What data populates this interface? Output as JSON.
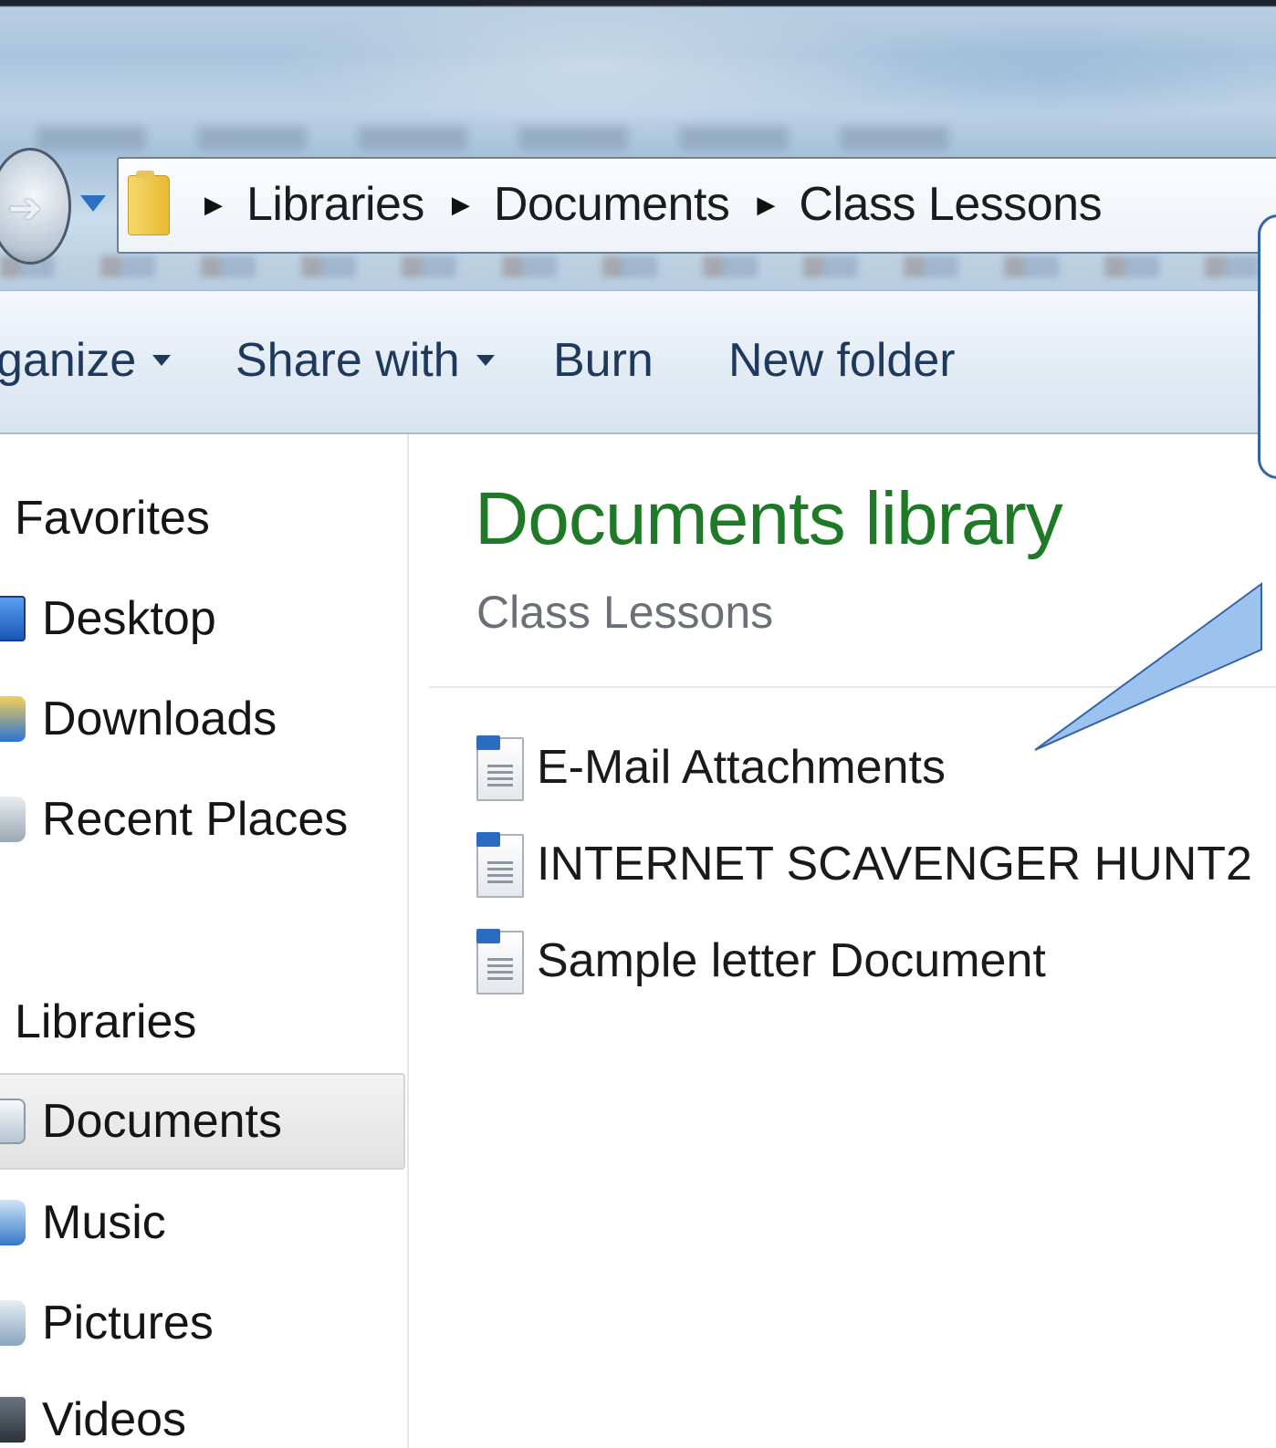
{
  "window": {
    "title": "",
    "colors": {
      "accent_green": "#1e7a26",
      "callout_border": "#3464a6",
      "callout_fill": "#9cc3ee"
    }
  },
  "navigation": {
    "back_icon": "back-arrow-icon",
    "dropdown_icon": "chevron-down-icon"
  },
  "address_bar": {
    "folder_icon": "folder-icon",
    "crumbs": [
      "Libraries",
      "Documents",
      "Class Lessons"
    ]
  },
  "command_bar": {
    "organize_label": "ganize",
    "share_label": "Share with",
    "burn_label": "Burn",
    "new_folder_label": "New folder"
  },
  "sidebar": {
    "favorites_header": "Favorites",
    "favorites": [
      {
        "label": "Desktop",
        "icon": "desktop-icon"
      },
      {
        "label": "Downloads",
        "icon": "downloads-icon"
      },
      {
        "label": "Recent Places",
        "icon": "recent-places-icon"
      }
    ],
    "libraries_header": "Libraries",
    "libraries": [
      {
        "label": "Documents",
        "icon": "documents-icon",
        "selected": true
      },
      {
        "label": "Music",
        "icon": "music-icon"
      },
      {
        "label": "Pictures",
        "icon": "pictures-icon"
      },
      {
        "label": "Videos",
        "icon": "videos-icon"
      }
    ]
  },
  "main": {
    "library_title": "Documents library",
    "subtitle": "Class Lessons",
    "files": [
      {
        "name": "E-Mail Attachments",
        "icon": "document-icon"
      },
      {
        "name": "INTERNET SCAVENGER HUNT2",
        "icon": "document-icon"
      },
      {
        "name": "Sample letter Document",
        "icon": "document-icon"
      }
    ]
  }
}
